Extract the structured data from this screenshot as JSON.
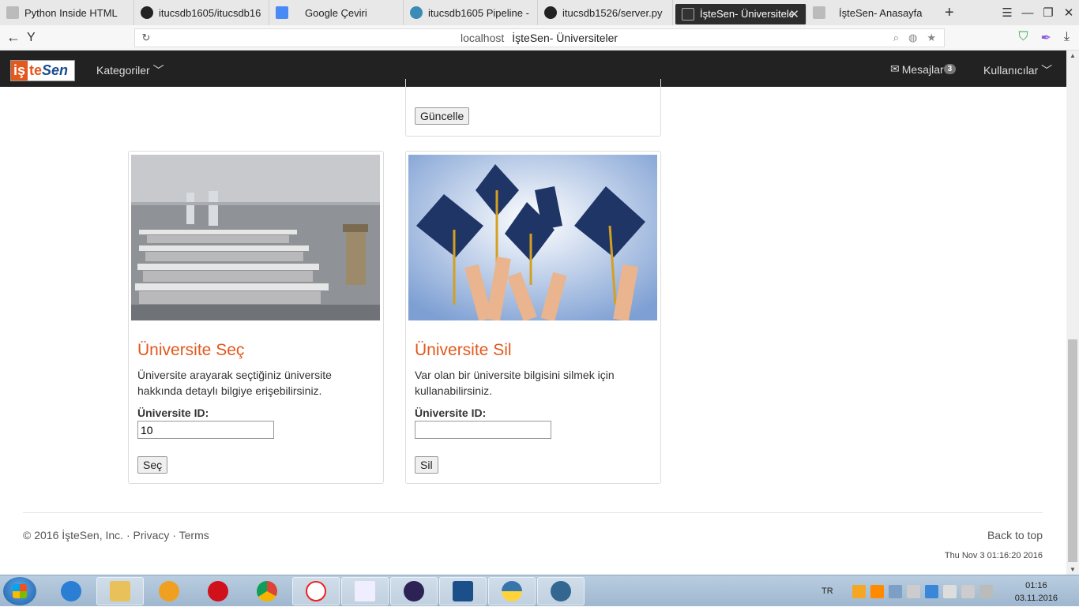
{
  "browser": {
    "tabs": [
      {
        "title": "Python Inside HTML",
        "icon": "page-icon",
        "active": false
      },
      {
        "title": "itucsdb1605/itucsdb16",
        "icon": "github-icon",
        "active": false
      },
      {
        "title": "Google Çeviri",
        "icon": "google-translate-icon",
        "active": false
      },
      {
        "title": "itucsdb1605 Pipeline -",
        "icon": "pipeline-icon",
        "active": false
      },
      {
        "title": "itucsdb1526/server.py",
        "icon": "github-icon",
        "active": false
      },
      {
        "title": "İşteSen- Üniversitele",
        "icon": "terminal-icon",
        "active": true
      },
      {
        "title": "İşteSen- Anasayfa",
        "icon": "page-icon",
        "active": false
      }
    ],
    "address": {
      "host": "localhost",
      "title": "İşteSen- Üniversiteler"
    }
  },
  "navbar": {
    "logo": {
      "part1": "iş",
      "part2": "te",
      "part3": "Sen"
    },
    "categories_label": "Kategoriler",
    "messages_label": "Mesajlar",
    "messages_count": "3",
    "users_label": "Kullanıcılar"
  },
  "top_panel": {
    "update_button": "Güncelle"
  },
  "cards": [
    {
      "title": "Üniversite Seç",
      "description": "Üniversite arayarak seçtiğiniz üniversite hakkında detaylı bilgiye erişebilirsiniz.",
      "id_label": "Üniversite ID:",
      "id_value": "10",
      "button": "Seç"
    },
    {
      "title": "Üniversite Sil",
      "description": "Var olan bir üniversite bilgisini silmek için kullanabilirsiniz.",
      "id_label": "Üniversite ID:",
      "id_value": "",
      "button": "Sil"
    }
  ],
  "footer": {
    "copyright": "© 2016 İşteSen, Inc.",
    "privacy": "Privacy",
    "terms": "Terms",
    "back_to_top": "Back to top",
    "datetime": "Thu Nov 3 01:16:20 2016"
  },
  "taskbar": {
    "language": "TR",
    "time": "01:16",
    "date": "03.11.2016"
  },
  "colors": {
    "accent": "#e2581d",
    "navbar": "#222222",
    "brand_blue": "#1a4b8f"
  }
}
